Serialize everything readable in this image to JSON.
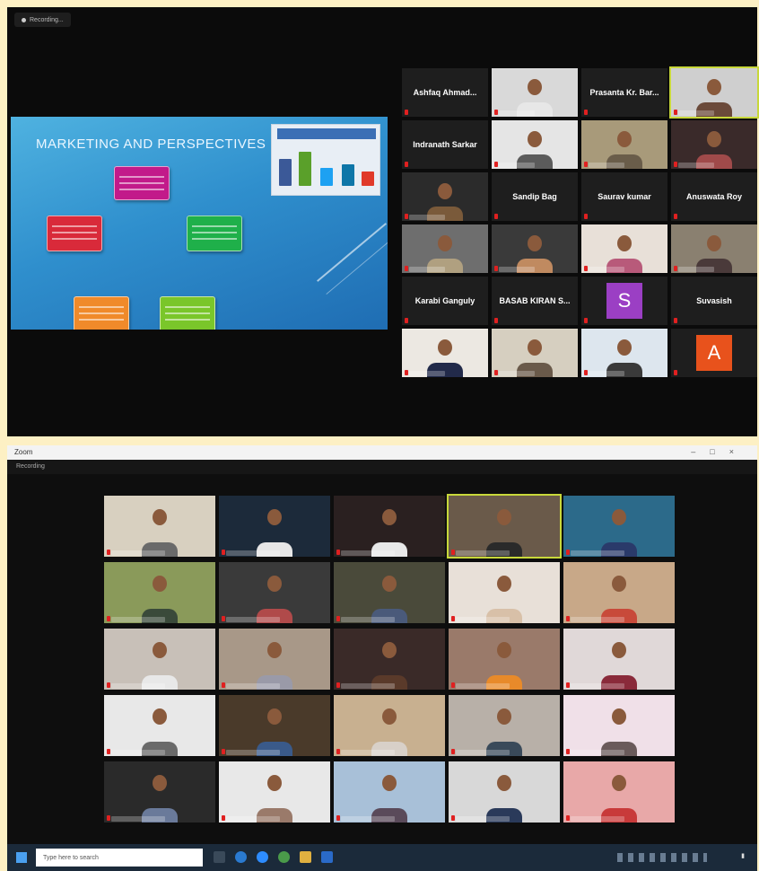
{
  "top_meeting": {
    "recording_label": "Recording...",
    "slide": {
      "title": "MARKETING AND PERSPECTIVES"
    },
    "grid": [
      {
        "type": "name",
        "label": "Ashfaq  Ahmad..."
      },
      {
        "type": "video",
        "color": "#d9d9d9",
        "shirt": "#e7e7e7"
      },
      {
        "type": "name",
        "label": "Prasanta Kr. Bar..."
      },
      {
        "type": "video",
        "color": "#cfcfcf",
        "shirt": "#6b4a3a",
        "active": true
      },
      {
        "type": "name",
        "label": "Indranath Sarkar"
      },
      {
        "type": "video",
        "color": "#e5e5e5",
        "shirt": "#5b5b5b"
      },
      {
        "type": "video",
        "color": "#a89a7a",
        "shirt": "#6a5d4a"
      },
      {
        "type": "video",
        "color": "#3a2a2a",
        "shirt": "#a04a4a"
      },
      {
        "type": "video",
        "color": "#2b2b2b",
        "shirt": "#7a5a3a"
      },
      {
        "type": "name",
        "label": "Sandip Bag"
      },
      {
        "type": "name",
        "label": "Saurav kumar"
      },
      {
        "type": "name",
        "label": "Anuswata Roy"
      },
      {
        "type": "video",
        "color": "#6e6e6e",
        "shirt": "#b0a080"
      },
      {
        "type": "video",
        "color": "#3a3a3a",
        "shirt": "#c08a60"
      },
      {
        "type": "video",
        "color": "#e8e0d8",
        "shirt": "#b85a7a"
      },
      {
        "type": "video",
        "color": "#8a8070",
        "shirt": "#4a3a3a"
      },
      {
        "type": "name",
        "label": "Karabi Ganguly"
      },
      {
        "type": "name",
        "label": "BASAB  KIRAN  S..."
      },
      {
        "type": "avatar",
        "letter": "S",
        "color": "#9b3fc4"
      },
      {
        "type": "name",
        "label": "Suvasish"
      },
      {
        "type": "video",
        "color": "#ece8e2",
        "shirt": "#222a4a"
      },
      {
        "type": "video",
        "color": "#d6cfc0",
        "shirt": "#6a5a4a"
      },
      {
        "type": "video",
        "color": "#dde6ee",
        "shirt": "#3a3a3a"
      },
      {
        "type": "avatar",
        "letter": "A",
        "color": "#e8521c"
      }
    ]
  },
  "bottom_meeting": {
    "window_app": "Zoom",
    "status": "Recording",
    "window_title": "",
    "grid": [
      {
        "color": "#d8d0c0",
        "shirt": "#6a6a6a"
      },
      {
        "color": "#1c2a3a",
        "shirt": "#e6e6e6"
      },
      {
        "color": "#2a2020",
        "shirt": "#e8e8e8"
      },
      {
        "color": "#6a5a4a",
        "shirt": "#2a2a2a",
        "active": true
      },
      {
        "color": "#2c6a8a",
        "shirt": "#2a3a6a"
      },
      {
        "color": "#8a9a5a",
        "shirt": "#3a4a3a"
      },
      {
        "color": "#3a3a3a",
        "shirt": "#b04a4a"
      },
      {
        "color": "#4a4a3a",
        "shirt": "#4a5a7a"
      },
      {
        "color": "#e8e0d8",
        "shirt": "#d8c0a8"
      },
      {
        "color": "#c8a888",
        "shirt": "#c84a3a"
      },
      {
        "color": "#c8c0b8",
        "shirt": "#e8e8e8"
      },
      {
        "color": "#a89888",
        "shirt": "#9a9aa8"
      },
      {
        "color": "#3a2a28",
        "shirt": "#5a3a2a"
      },
      {
        "color": "#9a7a6a",
        "shirt": "#e88a2a"
      },
      {
        "color": "#e0d8d8",
        "shirt": "#8a2a3a"
      },
      {
        "color": "#e8e8e8",
        "shirt": "#6a6a6a"
      },
      {
        "color": "#4a3a2a",
        "shirt": "#3a5a8a"
      },
      {
        "color": "#c8b090",
        "shirt": "#d8d0c8"
      },
      {
        "color": "#b8b0a8",
        "shirt": "#3a4a5a"
      },
      {
        "color": "#f0e0e8",
        "shirt": "#6a5a5a"
      },
      {
        "color": "#2a2a2a",
        "shirt": "#6a7a9a"
      },
      {
        "color": "#e8e8e8",
        "shirt": "#9a7a6a"
      },
      {
        "color": "#a8c0d8",
        "shirt": "#5a4a5a"
      },
      {
        "color": "#d8d8d8",
        "shirt": "#2a3a5a"
      },
      {
        "color": "#e8a8a8",
        "shirt": "#c83a3a"
      }
    ],
    "taskbar": {
      "search_placeholder": "Type here to search"
    }
  },
  "colors": {
    "frame_background": "#fdf0c4",
    "active_speaker_border": "#c8d83a",
    "muted_mic": "#e02020"
  }
}
